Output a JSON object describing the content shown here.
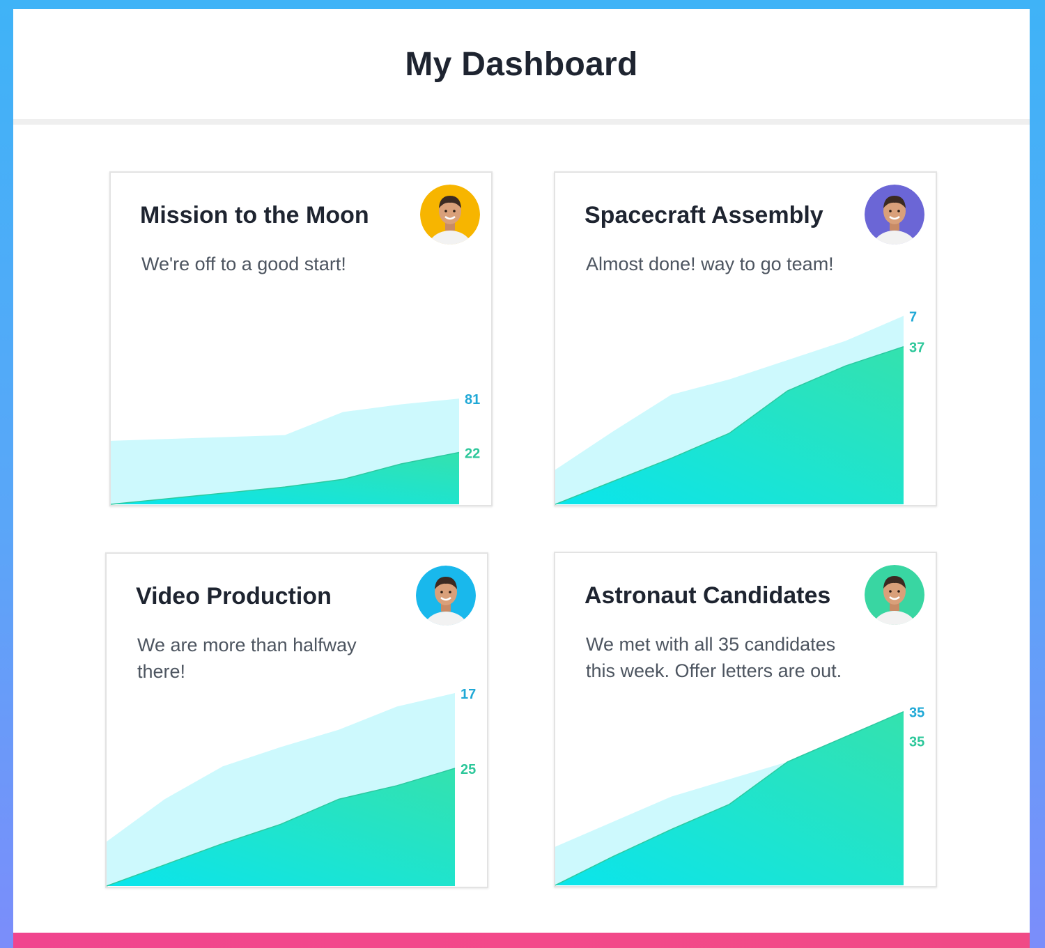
{
  "header": {
    "title": "My Dashboard"
  },
  "colors": {
    "background_gradient": [
      "#3fb3f7",
      "#7b8dfa"
    ],
    "accent_bar": "#f0458e",
    "total_area": "#cdf9fd",
    "progress_area": [
      "#0ae5ec",
      "#34e2ae"
    ],
    "total_label": "#1fa8d6",
    "progress_label": "#2cc79a"
  },
  "cards": [
    {
      "title": "Mission to the Moon",
      "description": "We're off to a good start!",
      "avatar": {
        "icon": "person-avatar-icon",
        "bg": "#f7b500"
      },
      "chart_data": {
        "type": "area",
        "total_label": "81",
        "progress_label": "22",
        "total": [
          0.33,
          0.34,
          0.35,
          0.36,
          0.48,
          0.52,
          0.55
        ],
        "progress": [
          0.0,
          0.03,
          0.06,
          0.09,
          0.13,
          0.21,
          0.27
        ]
      }
    },
    {
      "title": "Spacecraft Assembly",
      "description": "Almost done! way to go team!",
      "avatar": {
        "icon": "person-avatar-icon",
        "bg": "#6b66d6"
      },
      "chart_data": {
        "type": "area",
        "total_label": "7",
        "progress_label": "37",
        "total": [
          0.18,
          0.38,
          0.57,
          0.65,
          0.75,
          0.85,
          0.98
        ],
        "progress": [
          0.0,
          0.12,
          0.24,
          0.37,
          0.59,
          0.72,
          0.82
        ]
      }
    },
    {
      "title": "Video Production",
      "description": "We are more than halfway there!",
      "avatar": {
        "icon": "person-avatar-icon",
        "bg": "#19b8ec"
      },
      "chart_data": {
        "type": "area",
        "total_label": "17",
        "progress_label": "25",
        "total": [
          0.23,
          0.45,
          0.62,
          0.72,
          0.81,
          0.93,
          1.0
        ],
        "progress": [
          0.0,
          0.11,
          0.22,
          0.32,
          0.45,
          0.52,
          0.61
        ]
      }
    },
    {
      "title": "Astronaut Candidates",
      "description": "We met with all 35 candidates this week. Offer letters are out.",
      "avatar": {
        "icon": "person-avatar-icon",
        "bg": "#39d6a2"
      },
      "chart_data": {
        "type": "area",
        "total_label": "35",
        "progress_label": "35",
        "total": [
          0.2,
          0.33,
          0.46,
          0.55,
          0.64,
          0.77,
          0.9
        ],
        "progress": [
          0.0,
          0.15,
          0.29,
          0.42,
          0.64,
          0.77,
          0.9
        ]
      }
    }
  ]
}
